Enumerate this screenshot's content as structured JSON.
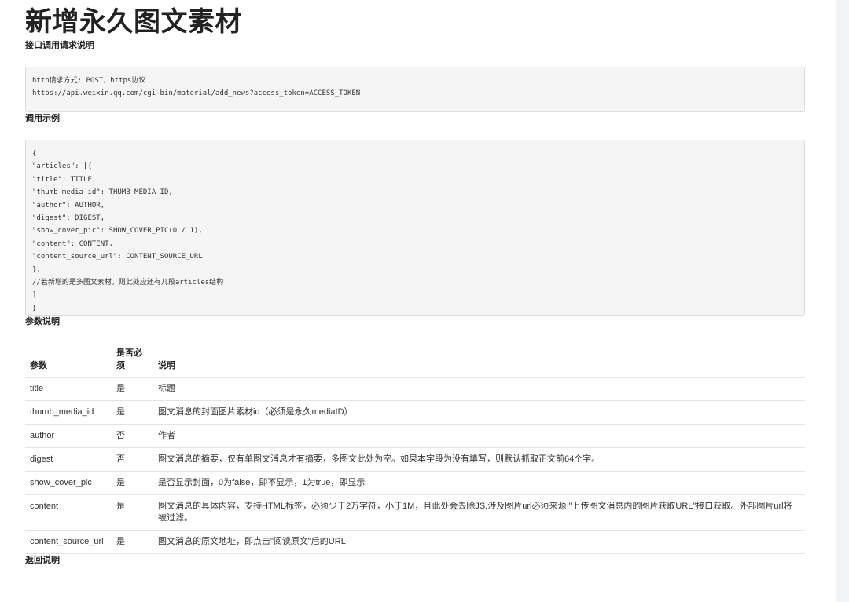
{
  "title": "新增永久图文素材",
  "sections": {
    "request": "接口调用请求说明",
    "example": "调用示例",
    "params": "参数说明",
    "response": "返回说明"
  },
  "request_code": [
    "http请求方式: POST，https协议",
    "https://api.weixin.qq.com/cgi-bin/material/add_news?access_token=ACCESS_TOKEN"
  ],
  "example_code": [
    "{",
    "\"articles\": [{",
    "\"title\": TITLE,",
    "\"thumb_media_id\": THUMB_MEDIA_ID,",
    "\"author\": AUTHOR,",
    "\"digest\": DIGEST,",
    "\"show_cover_pic\": SHOW_COVER_PIC(0 / 1),",
    "\"content\": CONTENT,",
    "\"content_source_url\": CONTENT_SOURCE_URL",
    "},",
    "//若新增的是多图文素材，则此处应还有几段articles结构",
    "]",
    "}"
  ],
  "table": {
    "headers": [
      "参数",
      "是否必须",
      "说明"
    ],
    "rows": [
      [
        "title",
        "是",
        "标题"
      ],
      [
        "thumb_media_id",
        "是",
        "图文消息的封面图片素材id（必须是永久mediaID）"
      ],
      [
        "author",
        "否",
        "作者"
      ],
      [
        "digest",
        "否",
        "图文消息的摘要，仅有单图文消息才有摘要，多图文此处为空。如果本字段为没有填写，则默认抓取正文前64个字。"
      ],
      [
        "show_cover_pic",
        "是",
        "是否显示封面，0为false，即不显示，1为true，即显示"
      ],
      [
        "content",
        "是",
        "图文消息的具体内容，支持HTML标签，必须少于2万字符，小于1M，且此处会去除JS,涉及图片url必须来源 \"上传图文消息内的图片获取URL\"接口获取。外部图片url将被过滤。"
      ],
      [
        "content_source_url",
        "是",
        "图文消息的原文地址，即点击\"阅读原文\"后的URL"
      ]
    ]
  }
}
